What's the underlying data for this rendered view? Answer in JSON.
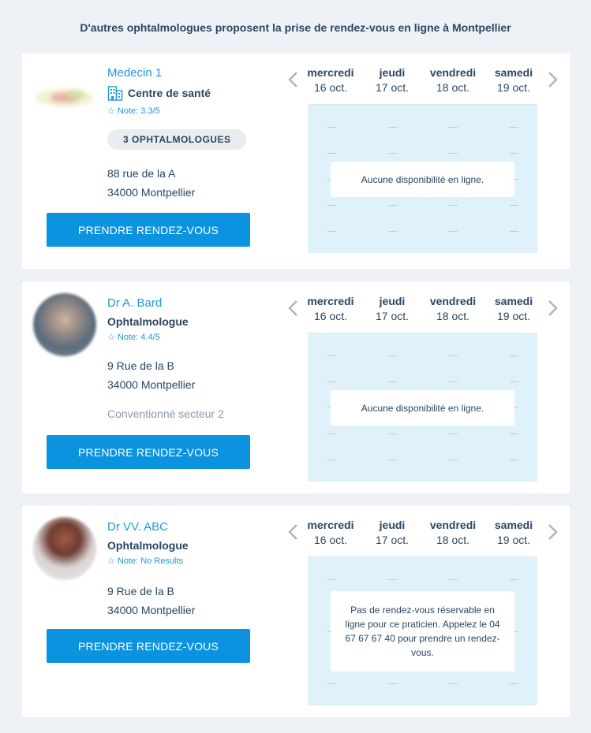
{
  "heading": "D'autres ophtalmologues proposent la prise de rendez-vous en ligne à Montpellier",
  "colors": {
    "accent": "#0b93e0",
    "link": "#1c9ad8",
    "slot_bg": "#dff2fc",
    "page_bg": "#eef2f6"
  },
  "days": [
    {
      "name": "mercredi",
      "date": "16 oct."
    },
    {
      "name": "jeudi",
      "date": "17 oct."
    },
    {
      "name": "vendredi",
      "date": "18 oct."
    },
    {
      "name": "samedi",
      "date": "19 oct."
    }
  ],
  "doctors": [
    {
      "name": "Medecin 1",
      "specialty": "Centre de santé",
      "specialty_icon": "building-icon",
      "rating": "☆ Note: 3.3/5",
      "badge": "3 OPHTALMOLOGUES",
      "address_line1": "88 rue de la A",
      "address_line2": "34000 Montpellier",
      "button": "PRENDRE RENDEZ-VOUS",
      "availability_message": "Aucune disponibilité en ligne."
    },
    {
      "name": "Dr A. Bard",
      "specialty": "Ophtalmologue",
      "rating": "☆ Note: 4.4/5",
      "address_line1": "9 Rue de la B",
      "address_line2": "34000 Montpellier",
      "sector": "Conventionné secteur 2",
      "button": "PRENDRE RENDEZ-VOUS",
      "availability_message": "Aucune disponibilité en ligne."
    },
    {
      "name": "Dr VV. ABC",
      "specialty": "Ophtalmologue",
      "rating": "☆ Note: No Results",
      "address_line1": "9 Rue de la B",
      "address_line2": "34000 Montpellier",
      "button": "PRENDRE RENDEZ-VOUS",
      "availability_message": "Pas de rendez-vous réservable en ligne pour ce praticien. Appelez le 04 67 67 67 40 pour prendre un rendez-vous."
    }
  ]
}
